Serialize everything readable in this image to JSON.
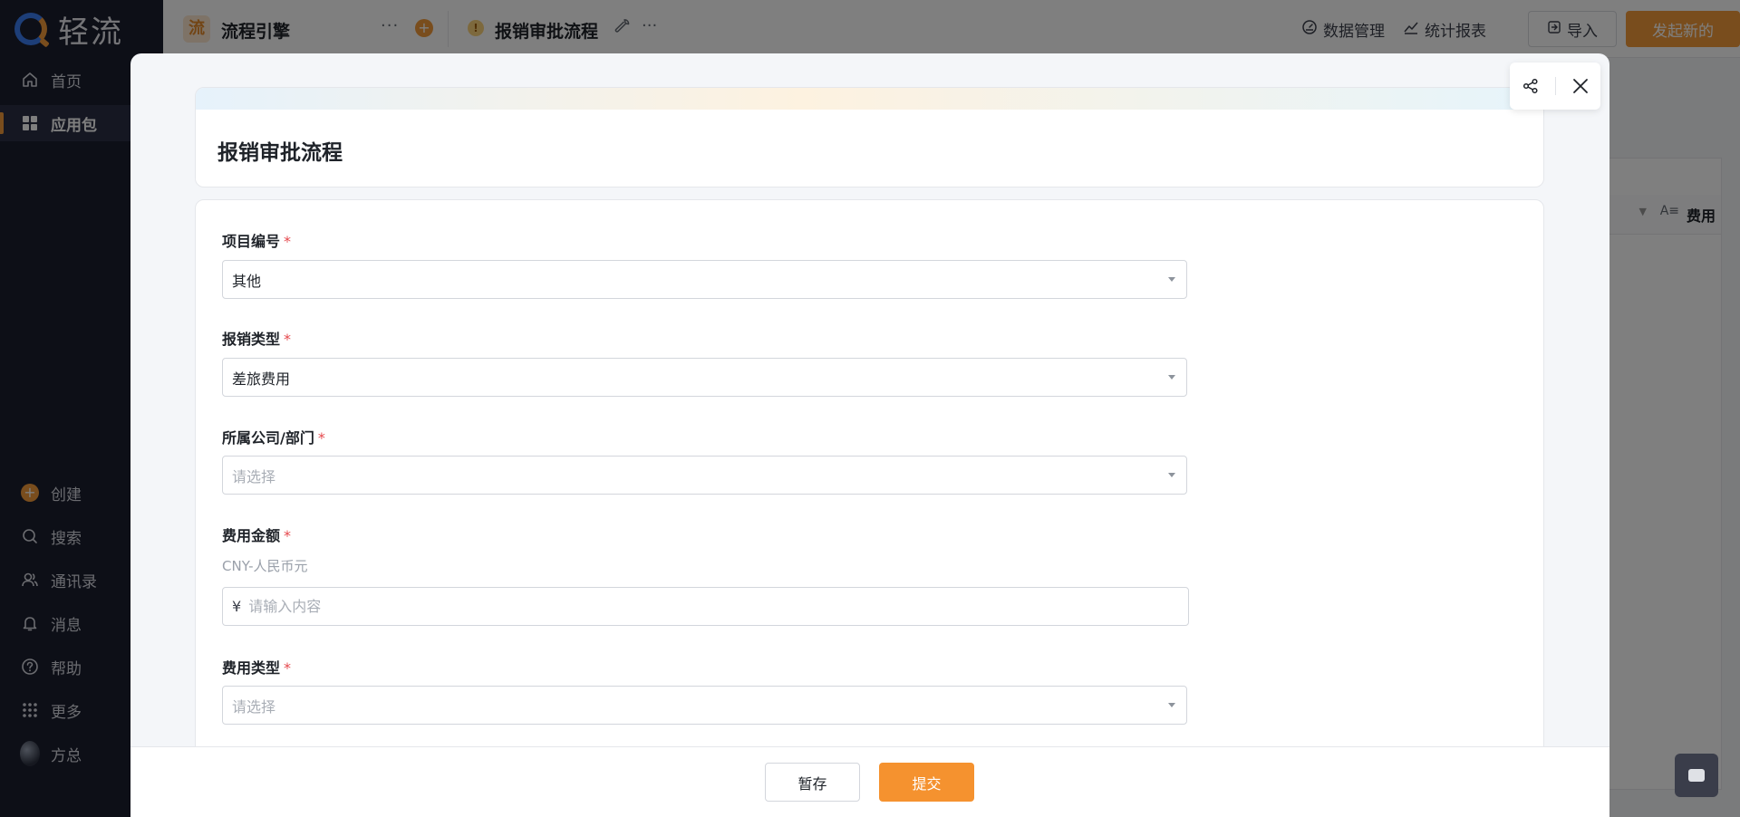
{
  "sidebar": {
    "logo_text": "轻流",
    "items": [
      {
        "label": "首页"
      },
      {
        "label": "应用包"
      },
      {
        "label": "创建"
      },
      {
        "label": "搜索"
      },
      {
        "label": "通讯录"
      },
      {
        "label": "消息"
      },
      {
        "label": "帮助"
      },
      {
        "label": "更多"
      },
      {
        "label": "方总"
      }
    ]
  },
  "topbar": {
    "app_badge": "流",
    "app_title": "流程引擎",
    "process_title": "报销审批流程",
    "links": [
      {
        "label": "数据管理"
      },
      {
        "label": "统计报表"
      }
    ],
    "import_label": "导入",
    "start_label": "发起新的"
  },
  "background": {
    "column_header": "费用"
  },
  "modal": {
    "form_title": "报销审批流程",
    "fields": [
      {
        "label": "项目编号",
        "required_mark": "*",
        "value": "其他"
      },
      {
        "label": "报销类型",
        "required_mark": "*",
        "value": "差旅费用"
      },
      {
        "label": "所属公司/部门",
        "required_mark": "*",
        "placeholder": "请选择"
      },
      {
        "label": "费用金额",
        "required_mark": "*",
        "currency_note": "CNY-人民币元",
        "currency_symbol": "¥",
        "placeholder": "请输入内容"
      },
      {
        "label": "费用类型",
        "required_mark": "*",
        "placeholder": "请选择"
      }
    ],
    "footer": {
      "save_label": "暂存",
      "submit_label": "提交"
    }
  },
  "colors": {
    "accent": "#f29b3a",
    "submit": "#f5922f",
    "sidebar_bg": "#1b1e2f",
    "required": "#e5484d"
  }
}
